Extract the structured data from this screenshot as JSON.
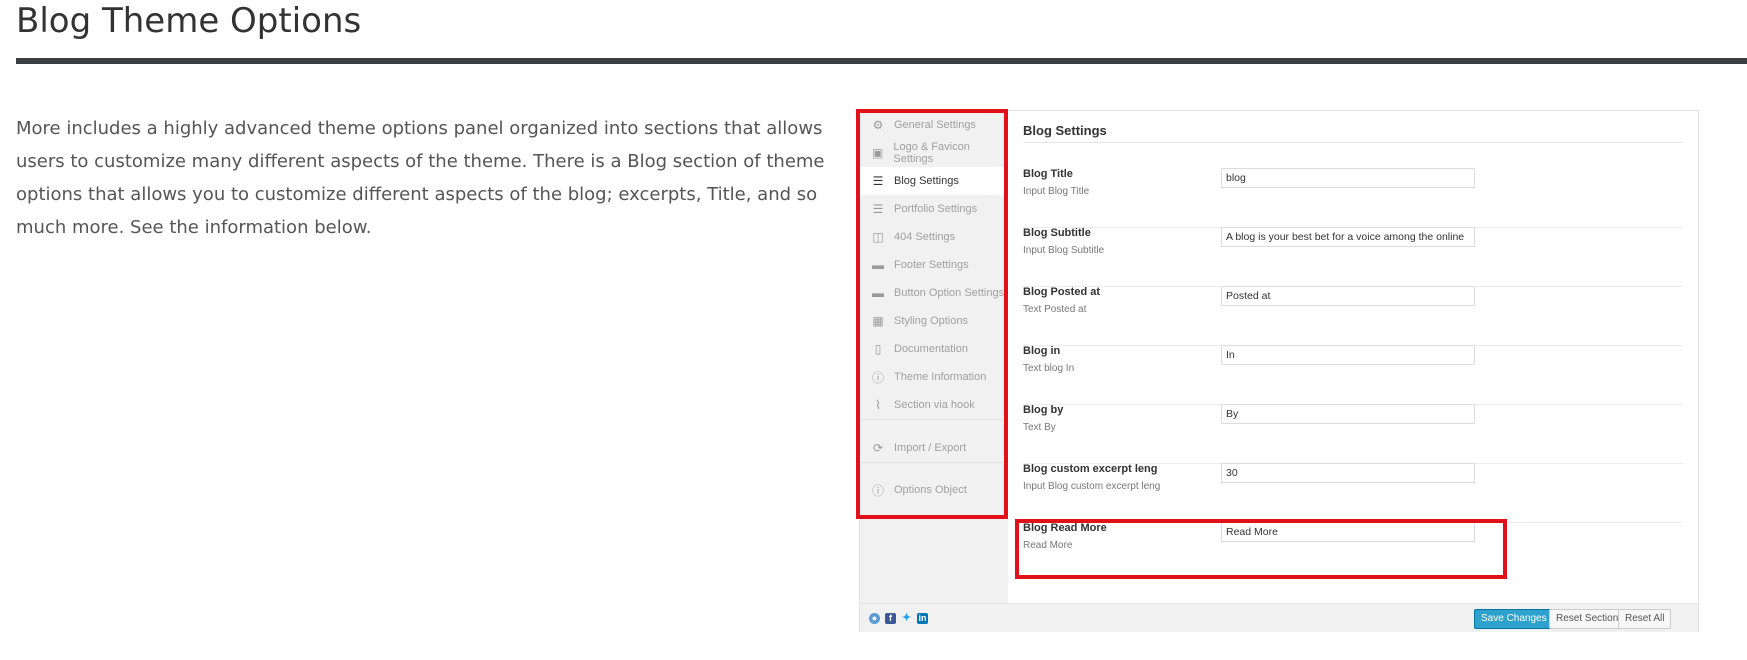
{
  "page": {
    "title": "Blog Theme Options",
    "intro": "More includes a highly advanced theme options panel organized into sections that allows users to customize many different aspects of the theme. There is a Blog section of theme options that allows you to customize different aspects of the blog; excerpts, Title, and so much more. See the information below."
  },
  "colors": {
    "highlight": "#e2101a",
    "primary_button": "#2ea2cc",
    "title_rule": "#3a3f44"
  },
  "panel": {
    "sidebar": [
      {
        "label": "General Settings",
        "icon": "cogs-icon",
        "active": false
      },
      {
        "label": "Logo & Favicon Settings",
        "icon": "image-icon",
        "active": false
      },
      {
        "label": "Blog Settings",
        "icon": "list-icon",
        "active": true
      },
      {
        "label": "Portfolio Settings",
        "icon": "list-icon",
        "active": false
      },
      {
        "label": "404 Settings",
        "icon": "chart-icon",
        "active": false
      },
      {
        "label": "Footer Settings",
        "icon": "card-icon",
        "active": false
      },
      {
        "label": "Button Option Settings",
        "icon": "card-icon",
        "active": false
      },
      {
        "label": "Styling Options",
        "icon": "grid-icon",
        "active": false
      },
      {
        "label": "Documentation",
        "icon": "clipboard-icon",
        "active": false
      },
      {
        "label": "Theme Information",
        "icon": "info-icon",
        "active": false
      },
      {
        "label": "Section via hook",
        "icon": "paperclip-icon",
        "active": false
      },
      {
        "label": "Import / Export",
        "icon": "refresh-icon",
        "active": false
      },
      {
        "label": "Options Object",
        "icon": "info-icon",
        "active": false
      }
    ],
    "content_title": "Blog Settings",
    "fields": [
      {
        "label": "Blog Title",
        "desc": "Input Blog Title",
        "value": "blog"
      },
      {
        "label": "Blog Subtitle",
        "desc": "Input Blog Subtitle",
        "value": "A blog is your best bet for a voice among the online"
      },
      {
        "label": "Blog Posted at",
        "desc": "Text Posted at",
        "value": "Posted at"
      },
      {
        "label": "Blog in",
        "desc": "Text blog In",
        "value": "In"
      },
      {
        "label": "Blog by",
        "desc": "Text By",
        "value": "By"
      },
      {
        "label": "Blog custom excerpt leng",
        "desc": "Input Blog custom excerpt leng",
        "value": "30"
      },
      {
        "label": "Blog Read More",
        "desc": "Read More",
        "value": "Read More"
      }
    ],
    "footer": {
      "social_icons": [
        "redux-icon",
        "facebook-icon",
        "twitter-icon",
        "linkedin-icon"
      ],
      "save_label": "Save Changes",
      "reset_section_label": "Reset Section",
      "reset_all_label": "Reset All"
    }
  }
}
